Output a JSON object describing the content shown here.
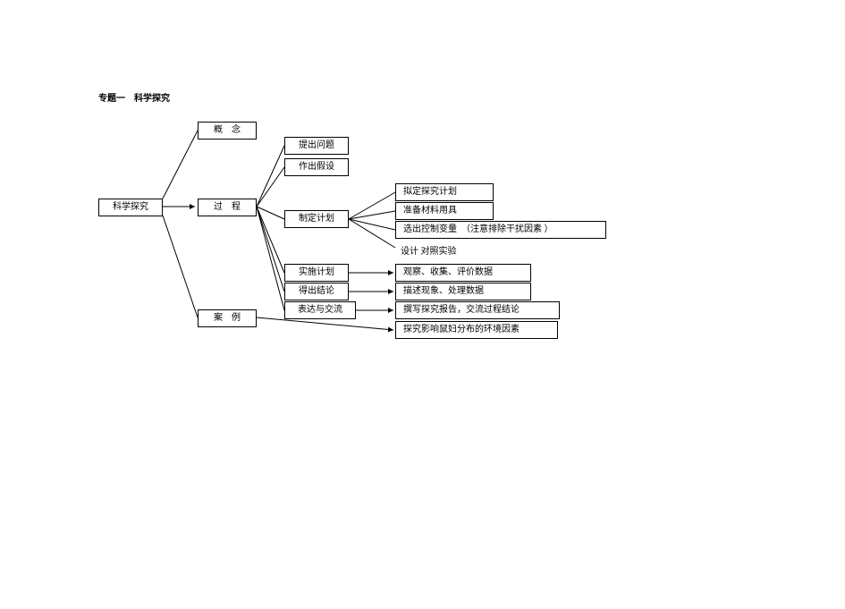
{
  "title": "专题一　科学探究",
  "root": "科学探究",
  "level1": {
    "concept": "概　念",
    "process": "过　程",
    "case": "案　例"
  },
  "steps": {
    "s1": "提出问题",
    "s2": "作出假设",
    "s3": "制定计划",
    "s4": "实施计划",
    "s5": "得出结论",
    "s6": "表达与交流"
  },
  "plan_sub": {
    "p1": "拟定探究计划",
    "p2": "准备材料用具",
    "p3": "选出控制变量　（注意排除干扰因素 ）",
    "design_label": "设计 对照实验"
  },
  "right": {
    "r_impl": "观察、收集、评价数据",
    "r_conc": "描述现象、处理数据",
    "r_comm": "撰写探究报告，交流过程结论"
  },
  "case_right": "探究影响鼠妇分布的环境因素"
}
